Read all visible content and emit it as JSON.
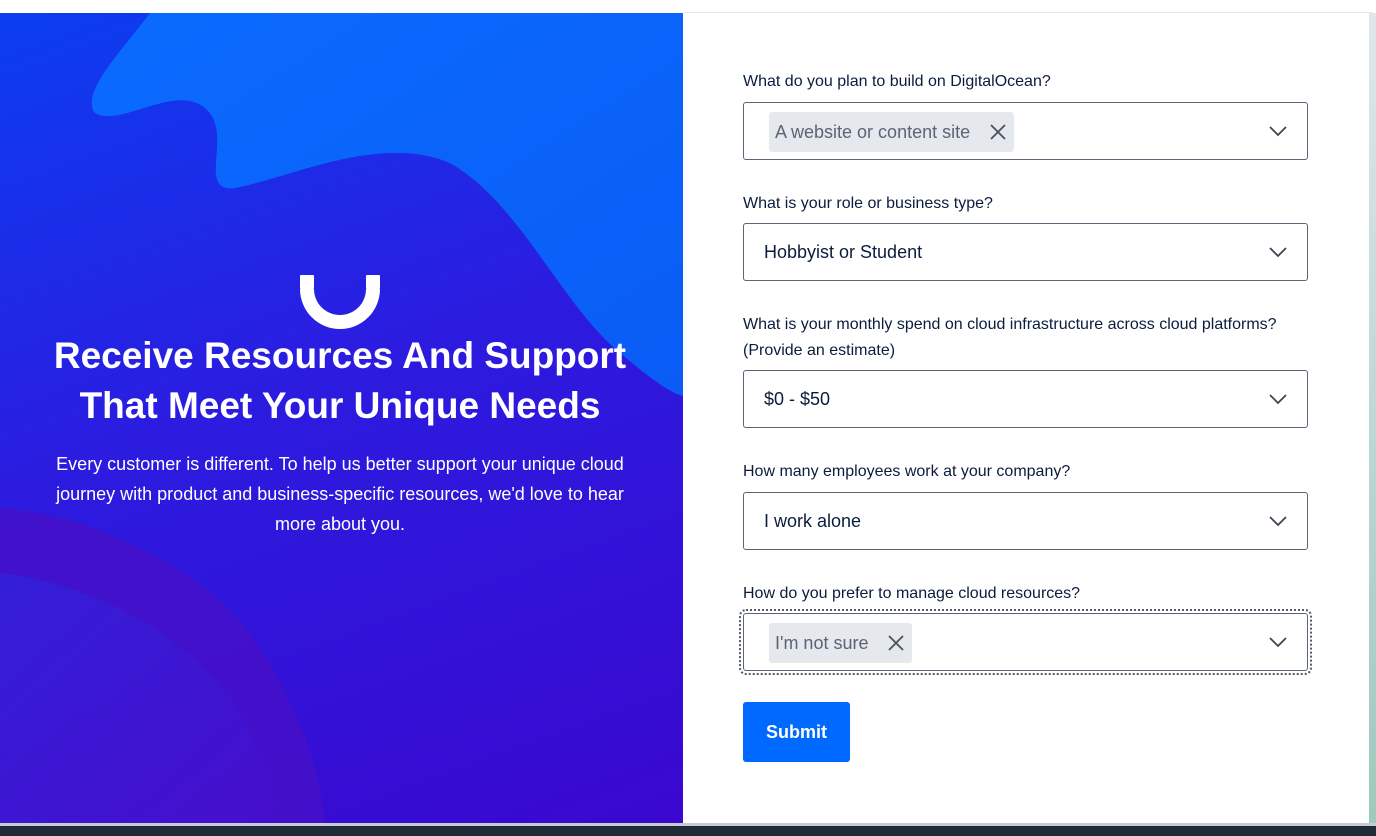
{
  "hero": {
    "title": "Receive Resources And Support That Meet Your Unique Needs",
    "description": "Every customer is different. To help us better support your unique cloud journey with product and business-specific resources, we'd love to hear more about you.",
    "colors": {
      "background": "#2b1ce0",
      "accent_wave": "#0069ff"
    }
  },
  "form": {
    "q1": {
      "label": "What do you plan to build on DigitalOcean?",
      "selected_chip": "A website or content site"
    },
    "q2": {
      "label": "What is your role or business type?",
      "value": "Hobbyist or Student"
    },
    "q3": {
      "label": "What is your monthly spend on cloud infrastructure across cloud platforms? (Provide an estimate)",
      "value": "$0 - $50"
    },
    "q4": {
      "label": "How many employees work at your company?",
      "value": "I work alone"
    },
    "q5": {
      "label": "How do you prefer to manage cloud resources?",
      "selected_chip": "I'm not sure"
    },
    "submit_label": "Submit"
  },
  "icons": {
    "dropdown": "chevron-down-icon",
    "remove_chip": "close-icon",
    "brand": "digitalocean-smile-logo"
  },
  "colors": {
    "primary": "#0069ff",
    "text": "#0b1c3c",
    "chip_bg": "#e5e8ed"
  }
}
